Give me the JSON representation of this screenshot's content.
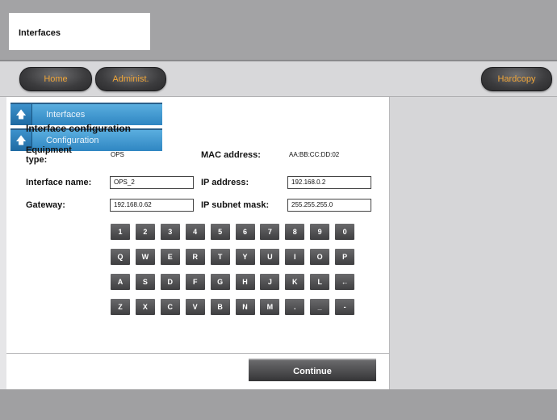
{
  "header": {
    "title": "Interfaces"
  },
  "nav": {
    "home": "Home",
    "admin": "Administ.",
    "hardcopy": "Hardcopy"
  },
  "sidebar": {
    "items": [
      {
        "label": "Interfaces",
        "icon": "up-arrow-icon"
      },
      {
        "label": "Configuration",
        "icon": "up-arrow-icon"
      }
    ]
  },
  "form": {
    "title": "Interface configuration",
    "equipment_type_label": "Equipment type:",
    "equipment_type_value": "OPS",
    "mac_label": "MAC address:",
    "mac_value": "AA:BB:CC:DD:02",
    "interface_name_label": "Interface name:",
    "interface_name_value": "OPS_2",
    "ip_label": "IP address:",
    "ip_value": "192.168.0.2",
    "gateway_label": "Gateway:",
    "gateway_value": "192.168.0.62",
    "subnet_label": "IP subnet mask:",
    "subnet_value": "255.255.255.0"
  },
  "keyboard": {
    "rows": [
      [
        "1",
        "2",
        "3",
        "4",
        "5",
        "6",
        "7",
        "8",
        "9",
        "0"
      ],
      [
        "Q",
        "W",
        "E",
        "R",
        "T",
        "Y",
        "U",
        "I",
        "O",
        "P"
      ],
      [
        "A",
        "S",
        "D",
        "F",
        "G",
        "H",
        "J",
        "K",
        "L",
        "←"
      ],
      [
        "Z",
        "X",
        "C",
        "V",
        "B",
        "N",
        "M",
        ".",
        "_",
        "-"
      ]
    ]
  },
  "actions": {
    "continue": "Continue"
  },
  "colors": {
    "accent_blue": "#3a8fcc",
    "nav_text": "#f0a63a"
  }
}
